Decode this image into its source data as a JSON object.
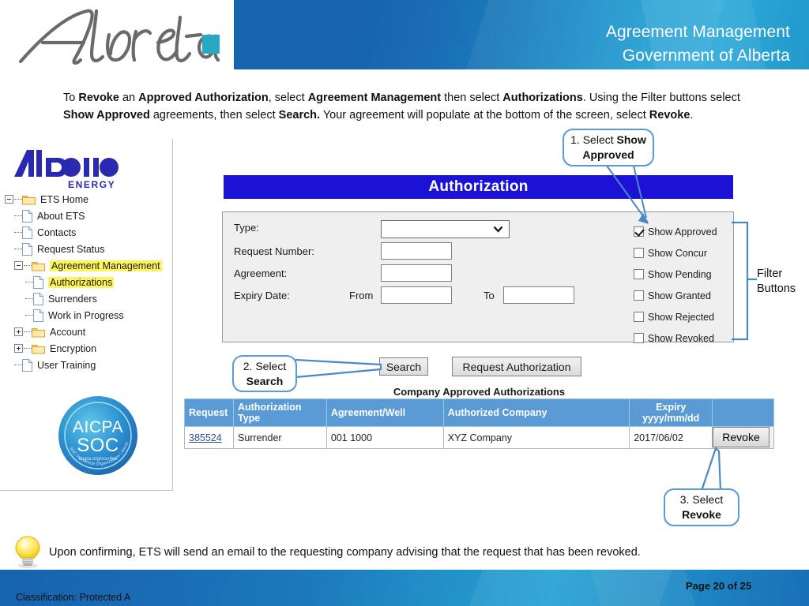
{
  "header": {
    "title_line1": "Agreement Management",
    "title_line2": "Government of Alberta",
    "logo_text": "Alberta"
  },
  "instructions": {
    "t1": "To ",
    "b1": "Revoke",
    "t2": " an ",
    "b2": "Approved Authorization",
    "t3": ", select ",
    "b3": "Agreement Management",
    "t4": " then select ",
    "b4": "Authorizations",
    "t5": ".  Using the Filter buttons select ",
    "b5": "Show Approved",
    "t6": " agreements, then select ",
    "b6": "Search.",
    "t7": "  Your agreement will populate at the bottom of the screen, select ",
    "b7": "Revoke",
    "t8": "."
  },
  "sidebar": {
    "logo_main": "Alberta",
    "logo_sub": "ENERGY",
    "items": [
      {
        "label": "ETS Home",
        "type": "folder",
        "level": 0,
        "expander": "minus",
        "highlight": false
      },
      {
        "label": "About ETS",
        "type": "file",
        "level": 1,
        "expander": "none",
        "highlight": false
      },
      {
        "label": "Contacts",
        "type": "file",
        "level": 1,
        "expander": "none",
        "highlight": false
      },
      {
        "label": "Request Status",
        "type": "file",
        "level": 1,
        "expander": "none",
        "highlight": false
      },
      {
        "label": "Agreement Management",
        "type": "folder",
        "level": 1,
        "expander": "minus",
        "highlight": true
      },
      {
        "label": "Authorizations",
        "type": "file",
        "level": 2,
        "expander": "none",
        "highlight": true
      },
      {
        "label": "Surrenders",
        "type": "file",
        "level": 2,
        "expander": "none",
        "highlight": false
      },
      {
        "label": "Work in Progress",
        "type": "file",
        "level": 2,
        "expander": "none",
        "highlight": false
      },
      {
        "label": "Account",
        "type": "folder",
        "level": 1,
        "expander": "plus",
        "highlight": false
      },
      {
        "label": "Encryption",
        "type": "folder",
        "level": 1,
        "expander": "plus",
        "highlight": false
      },
      {
        "label": "User Training",
        "type": "file",
        "level": 1,
        "expander": "none",
        "highlight": false
      }
    ],
    "soc_badge": {
      "line1": "AICPA",
      "line2": "SOC",
      "line3": "aicpa.org/soc4so"
    }
  },
  "auth_panel": {
    "title": "Authorization",
    "fields": {
      "type_label": "Type:",
      "type_value": "",
      "request_number_label": "Request Number:",
      "request_number_value": "",
      "agreement_label": "Agreement:",
      "agreement_value": "",
      "expiry_label": "Expiry Date:",
      "from_label": "From",
      "from_value": "",
      "to_label": "To",
      "to_value": ""
    },
    "filters": [
      {
        "label": "Show Approved",
        "checked": true
      },
      {
        "label": "Show Concur",
        "checked": false
      },
      {
        "label": "Show Pending",
        "checked": false
      },
      {
        "label": "Show Granted",
        "checked": false
      },
      {
        "label": "Show Rejected",
        "checked": false
      },
      {
        "label": "Show Revoked",
        "checked": false
      }
    ],
    "filter_bracket_label_l1": "Filter",
    "filter_bracket_label_l2": "Buttons",
    "buttons": {
      "search": "Search",
      "request_authorization": "Request Authorization"
    }
  },
  "results": {
    "caption": "Company Approved Authorizations",
    "columns": [
      "Request",
      "Authorization Type",
      "Agreement/Well",
      "Authorized Company",
      "Expiry yyyy/mm/dd",
      ""
    ],
    "col_expiry_l1": "Expiry",
    "col_expiry_l2": "yyyy/mm/dd",
    "col_authtype_l1": "Authorization",
    "col_authtype_l2": "Type",
    "rows": [
      {
        "request": "385524",
        "auth_type": "Surrender",
        "agreement_well": "001 1000",
        "authorized_company": "XYZ Company",
        "expiry": "2017/06/02",
        "action": "Revoke"
      }
    ]
  },
  "callouts": {
    "one_prefix": "1. Select ",
    "one_bold": "Show Approved",
    "two_prefix": "2. Select",
    "two_bold": "Search",
    "three_prefix": "3. Select",
    "three_bold": "Revoke"
  },
  "tip": {
    "text": "Upon confirming, ETS will send an email to the requesting company advising that the request that has been revoked."
  },
  "footer": {
    "classification": "Classification: Protected A",
    "page": "Page 20 of 25"
  },
  "colors": {
    "banner_blue": "#1763ad",
    "banner_cyan": "#2ba8d8",
    "auth_title_blue": "#1c12d6",
    "table_header_blue": "#5b9bd5",
    "callout_border": "#5b9ad5",
    "highlight_yellow": "#fff45c",
    "logo_square": "#29a8c4"
  }
}
